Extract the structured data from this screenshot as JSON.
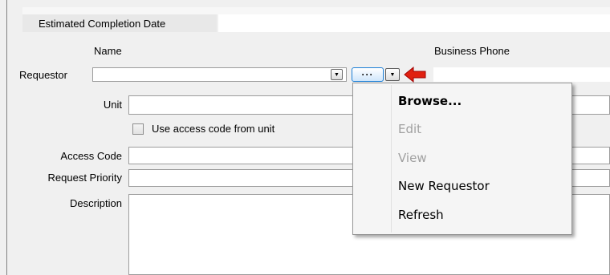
{
  "header": {
    "estimated_completion_label": "Estimated Completion Date"
  },
  "columns": {
    "name_label": "Name",
    "business_phone_label": "Business Phone"
  },
  "requestor": {
    "label": "Requestor",
    "value": "",
    "browse_button_label": "···"
  },
  "fields": {
    "unit_label": "Unit",
    "use_access_code_label": "Use access code from unit",
    "use_access_code_checked": false,
    "access_code_label": "Access Code",
    "request_priority_label": "Request Priority",
    "description_label": "Description"
  },
  "context_menu": {
    "items": [
      {
        "label": "Browse...",
        "enabled": true,
        "default": true
      },
      {
        "label": "Edit",
        "enabled": false
      },
      {
        "label": "View",
        "enabled": false
      },
      {
        "label": "New Requestor",
        "enabled": true
      },
      {
        "label": "Refresh",
        "enabled": true
      }
    ]
  },
  "colors": {
    "pointer_arrow": "#e02010",
    "button_border": "#1c7fd6",
    "disabled_text": "#a0a0a0"
  }
}
